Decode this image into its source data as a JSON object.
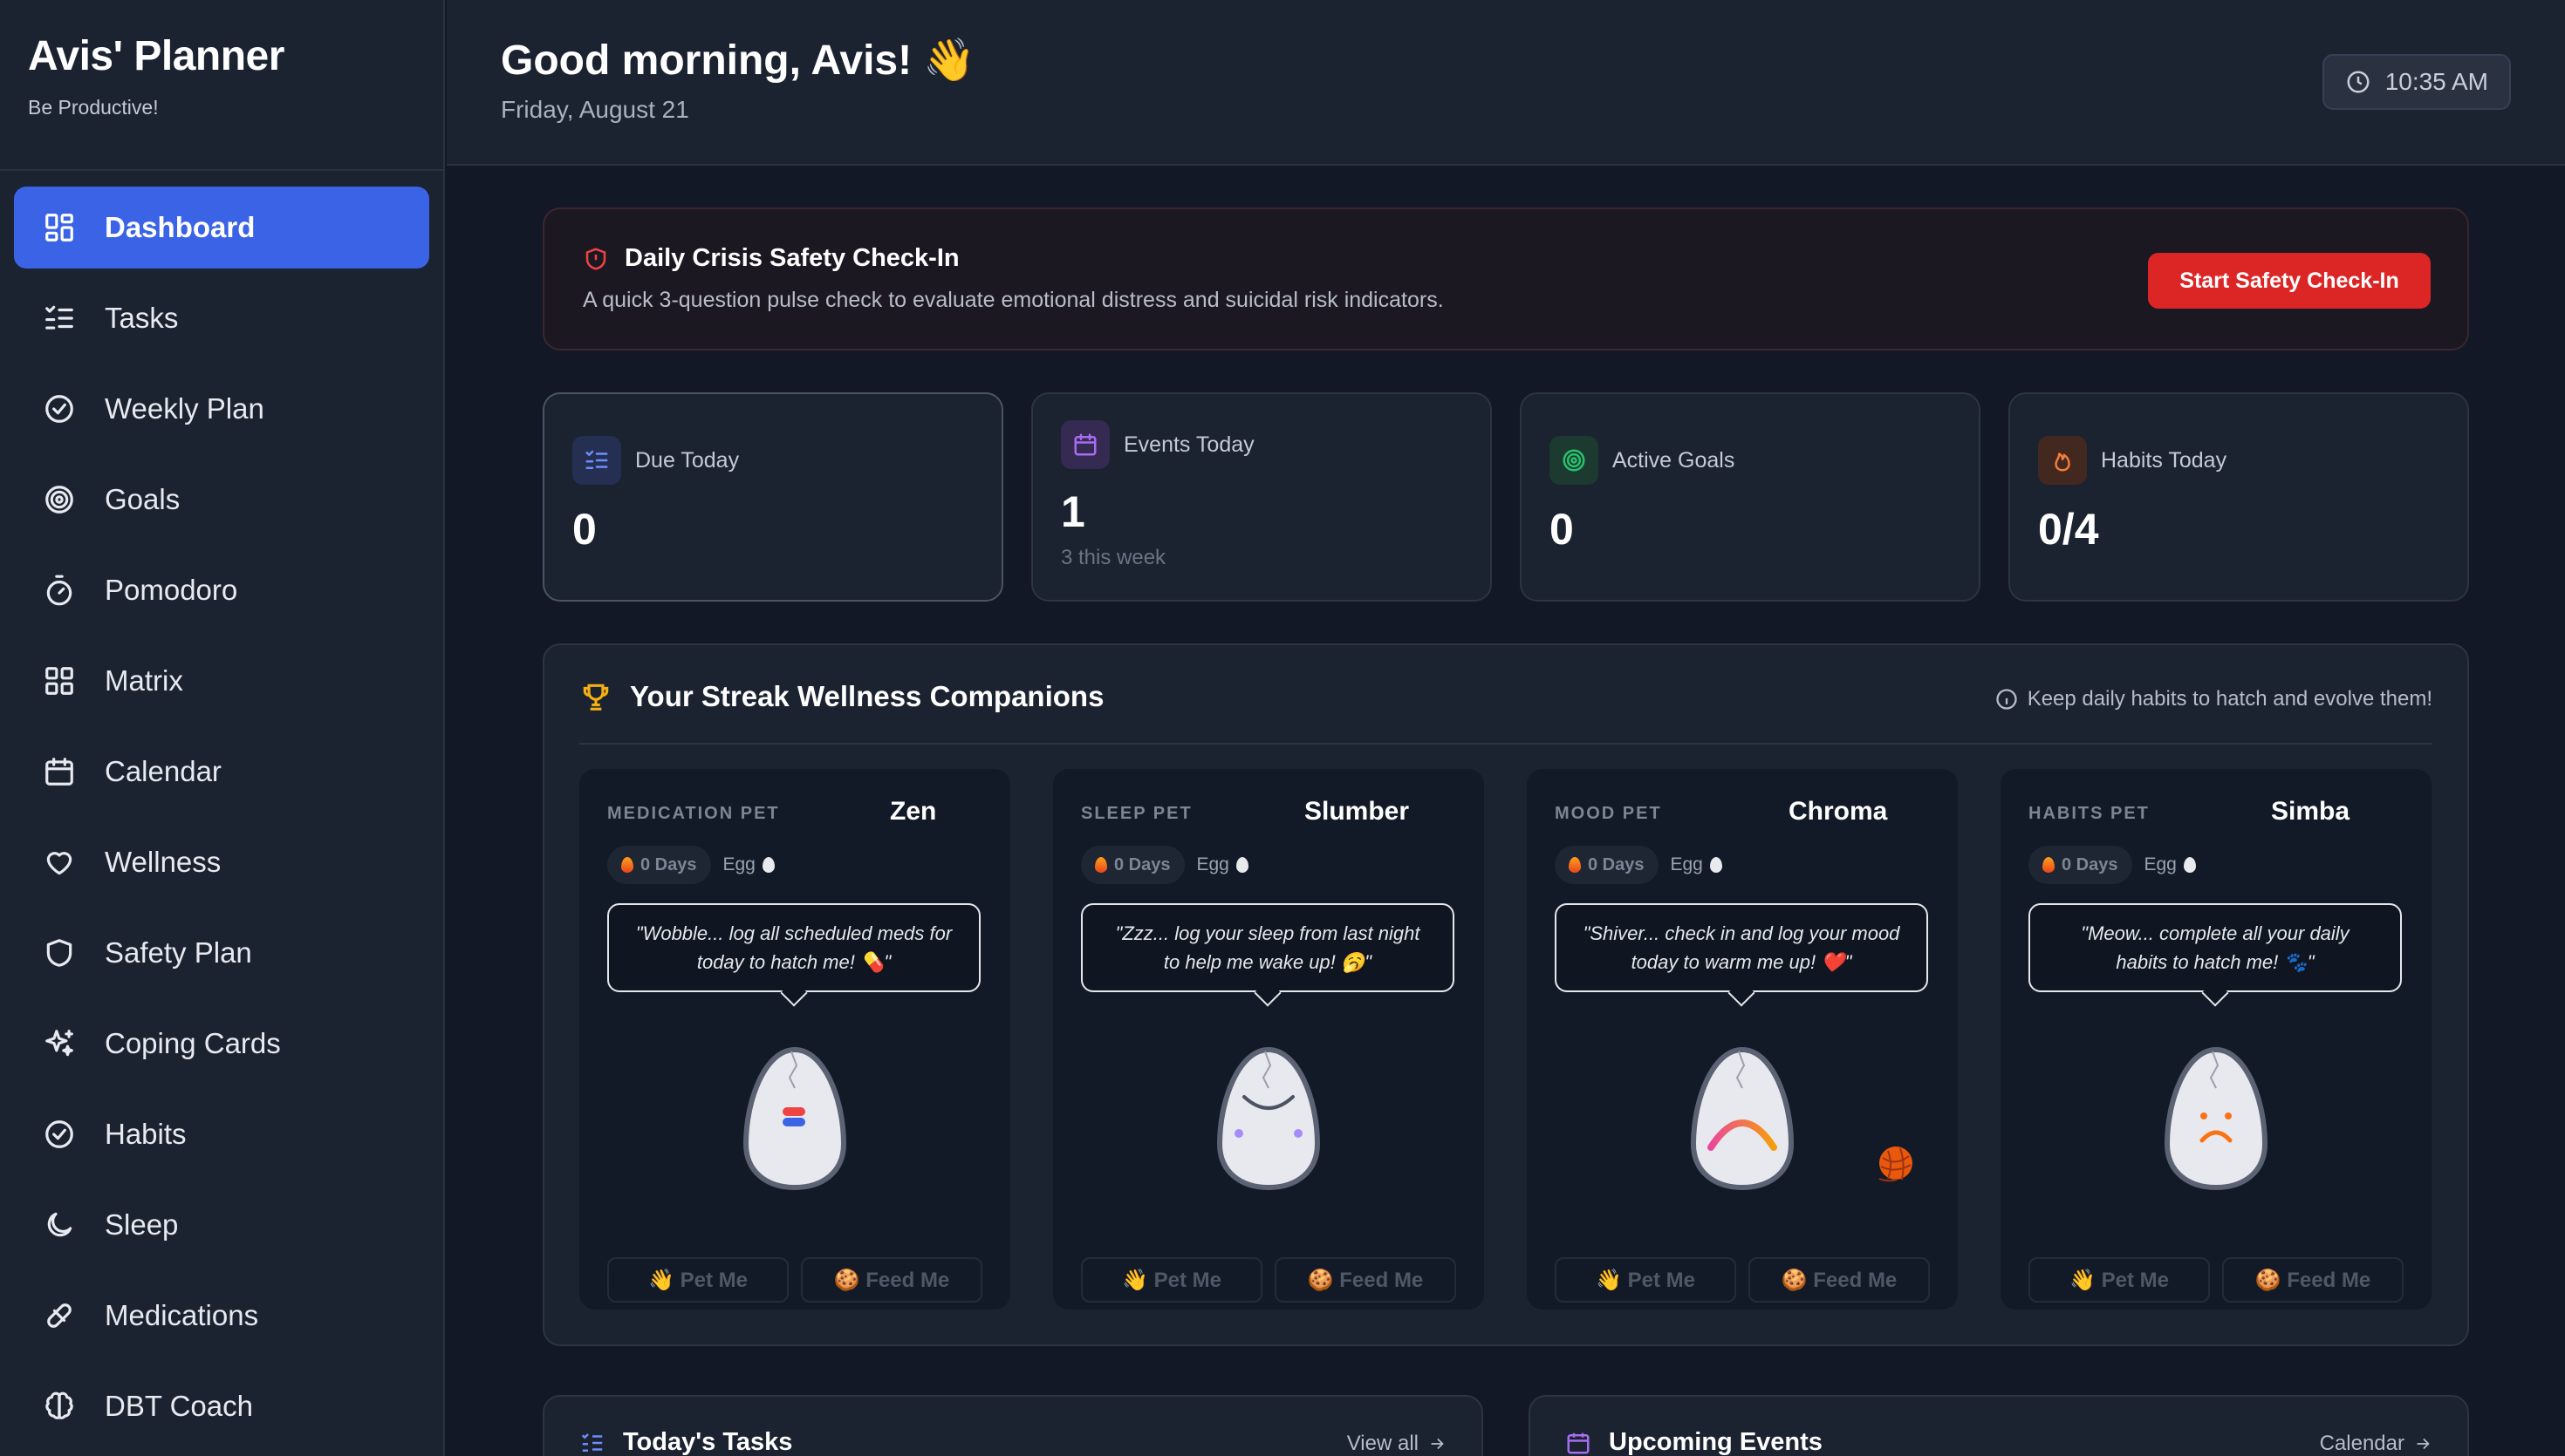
{
  "app": {
    "title": "Avis' Planner",
    "subtitle": "Be Productive!"
  },
  "sidebar": {
    "items": [
      {
        "label": "Dashboard",
        "icon": "dashboard-icon",
        "active": true
      },
      {
        "label": "Tasks",
        "icon": "tasks-icon"
      },
      {
        "label": "Weekly Plan",
        "icon": "check-circle-icon"
      },
      {
        "label": "Goals",
        "icon": "target-icon"
      },
      {
        "label": "Pomodoro",
        "icon": "timer-icon"
      },
      {
        "label": "Matrix",
        "icon": "grid-icon"
      },
      {
        "label": "Calendar",
        "icon": "calendar-icon"
      },
      {
        "label": "Wellness",
        "icon": "heart-icon"
      },
      {
        "label": "Safety Plan",
        "icon": "shield-icon"
      },
      {
        "label": "Coping Cards",
        "icon": "sparkles-icon"
      },
      {
        "label": "Habits",
        "icon": "check-circle-icon"
      },
      {
        "label": "Sleep",
        "icon": "moon-icon"
      },
      {
        "label": "Medications",
        "icon": "pill-icon"
      },
      {
        "label": "DBT Coach",
        "icon": "brain-icon"
      }
    ]
  },
  "header": {
    "greeting": "Good morning, Avis! 👋",
    "date": "Friday, August 21",
    "time": "10:35 AM"
  },
  "crisis": {
    "title": "Daily Crisis Safety Check-In",
    "description": "A quick 3-question pulse check to evaluate emotional distress and suicidal risk indicators.",
    "button": "Start Safety Check-In"
  },
  "stats": [
    {
      "label": "Due Today",
      "value": "0",
      "sub": "",
      "icon": "tasks-icon",
      "color": "#6d8dff"
    },
    {
      "label": "Events Today",
      "value": "1",
      "sub": "3 this week",
      "icon": "calendar-icon",
      "color": "#a66df0"
    },
    {
      "label": "Active Goals",
      "value": "0",
      "sub": "",
      "icon": "target-icon",
      "color": "#27c26c"
    },
    {
      "label": "Habits Today",
      "value": "0/4",
      "sub": "",
      "icon": "flame-icon",
      "color": "#f27c3a"
    }
  ],
  "companions": {
    "title": "Your Streak Wellness Companions",
    "hint": "Keep daily habits to hatch and evolve them!",
    "pets": [
      {
        "type": "MEDICATION PET",
        "name": "Zen",
        "days": "0 Days",
        "stage": "Egg",
        "quote": "\"Wobble... log all scheduled meds for today to hatch me! 💊\"",
        "pet_button": "👋 Pet Me",
        "feed_button": "🍪 Feed Me"
      },
      {
        "type": "SLEEP PET",
        "name": "Slumber",
        "days": "0 Days",
        "stage": "Egg",
        "quote": "\"Zzz... log your sleep from last night to help me wake up! 🥱\"",
        "pet_button": "👋 Pet Me",
        "feed_button": "🍪 Feed Me"
      },
      {
        "type": "MOOD PET",
        "name": "Chroma",
        "days": "0 Days",
        "stage": "Egg",
        "quote": "\"Shiver... check in and log your mood today to warm me up! ❤️\"",
        "pet_button": "👋 Pet Me",
        "feed_button": "🍪 Feed Me"
      },
      {
        "type": "HABITS PET",
        "name": "Simba",
        "days": "0 Days",
        "stage": "Egg",
        "quote": "\"Meow... complete all your daily habits to hatch me! 🐾\"",
        "pet_button": "👋 Pet Me",
        "feed_button": "🍪 Feed Me"
      }
    ]
  },
  "tasks_card": {
    "title": "Today's Tasks",
    "link": "View all"
  },
  "events_card": {
    "title": "Upcoming Events",
    "link": "Calendar"
  },
  "colors": {
    "accent": "#3b63e5",
    "danger": "#dc2626",
    "trophy": "#f5b014"
  }
}
